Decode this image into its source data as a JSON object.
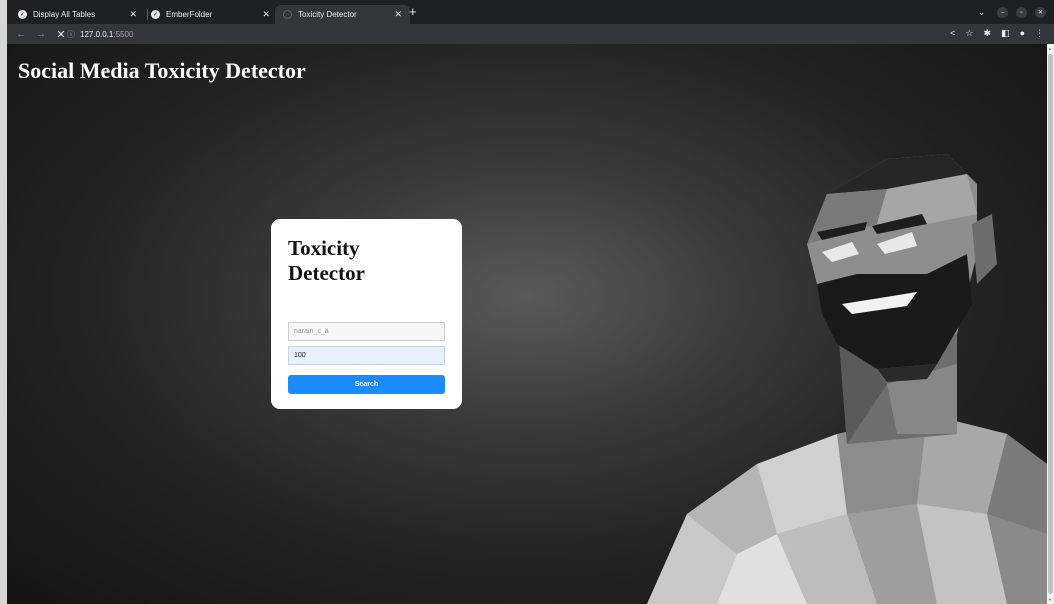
{
  "browser": {
    "tabs": [
      {
        "title": "Display All Tables",
        "active": false
      },
      {
        "title": "EmberFolder",
        "active": false
      },
      {
        "title": "Toxicity Detector",
        "active": true
      }
    ],
    "new_tab_label": "+",
    "url_host": "127.0.0.1",
    "url_port": ":5500"
  },
  "page": {
    "site_title": "Social Media Toxicity Detector",
    "card": {
      "heading": "Toxicity Detector",
      "username_placeholder": "narain_c_a",
      "count_value": "100",
      "search_label": "Search"
    }
  },
  "colors": {
    "accent": "#1a8cff",
    "background_dark": "#202124"
  }
}
